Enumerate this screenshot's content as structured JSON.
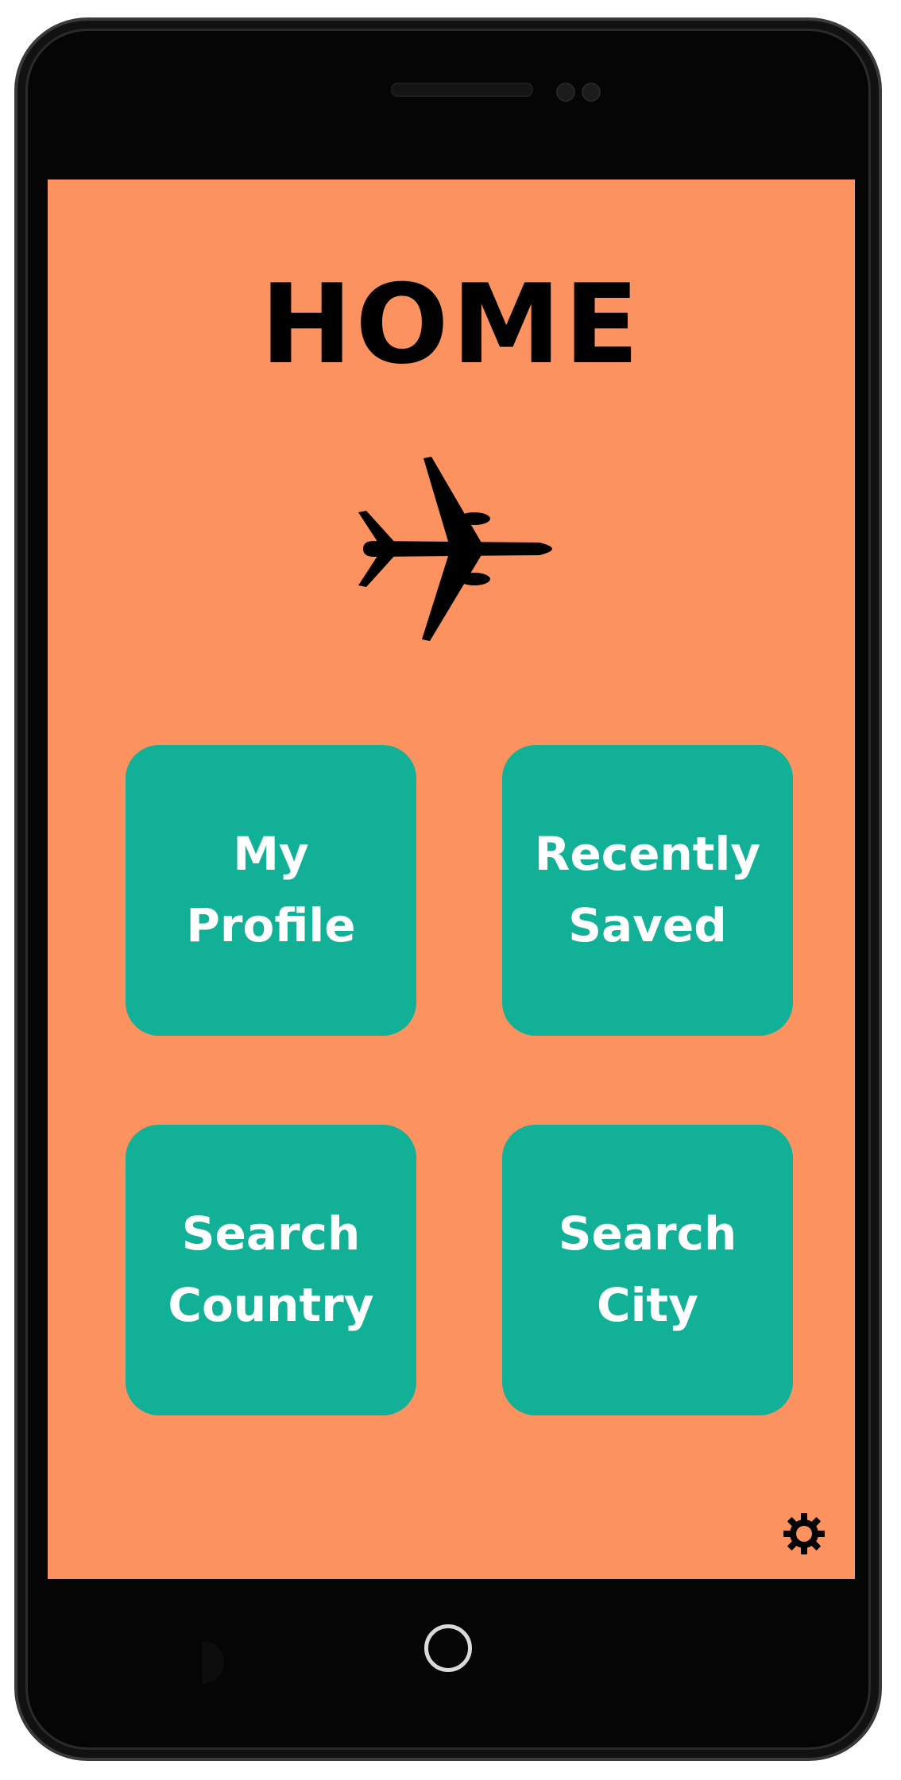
{
  "screen": {
    "title": "HOME",
    "background": "#fc9260"
  },
  "hero_icon": "airplane-icon",
  "tiles": [
    {
      "line1": "My",
      "line2": "Profile"
    },
    {
      "line1": "Recently",
      "line2": "Saved"
    },
    {
      "line1": "Search",
      "line2": "Country"
    },
    {
      "line1": "Search",
      "line2": "City"
    }
  ],
  "tile_color": "#12b197",
  "settings_icon": "gear-icon",
  "device": {
    "home_button_icon": "circle-home-icon"
  }
}
